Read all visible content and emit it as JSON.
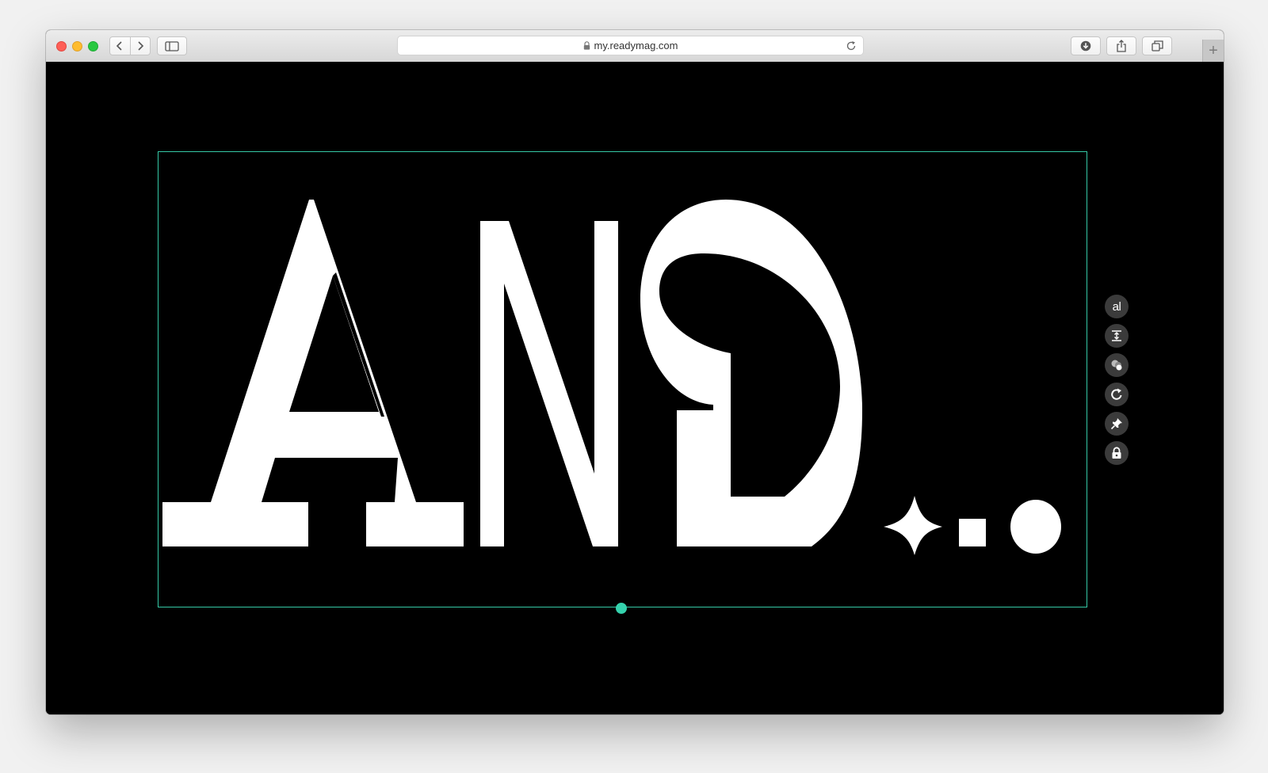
{
  "browser": {
    "url": "my.readymag.com",
    "new_tab_glyph": "+"
  },
  "canvas": {
    "artwork_label": "AND",
    "selection_color": "#35c9a6",
    "handle_color": "#35d2ad",
    "background": "#000000",
    "glyph_color": "#ffffff"
  },
  "toolbar": {
    "items": [
      {
        "icon": "text-icon",
        "label": "al"
      },
      {
        "icon": "align-icon"
      },
      {
        "icon": "effects-icon"
      },
      {
        "icon": "rotate-icon"
      },
      {
        "icon": "pin-icon"
      },
      {
        "icon": "lock-icon"
      }
    ]
  }
}
